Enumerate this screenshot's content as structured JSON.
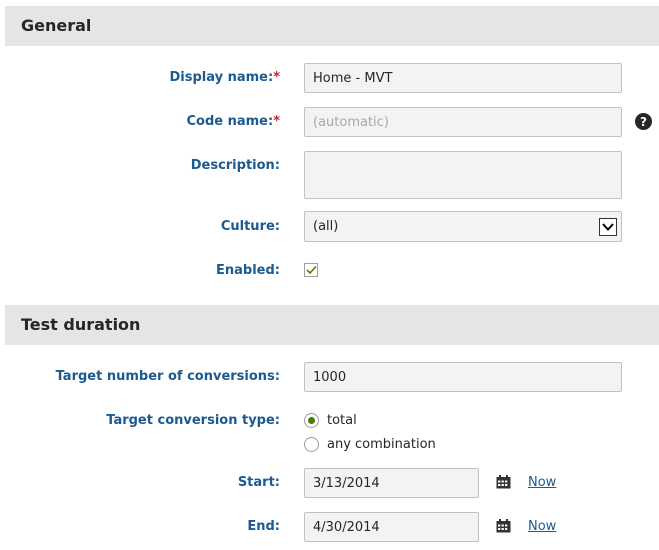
{
  "general": {
    "title": "General",
    "display_name": {
      "label": "Display name:",
      "required": "*",
      "value": "Home - MVT"
    },
    "code_name": {
      "label": "Code name:",
      "required": "*",
      "placeholder": "(automatic)",
      "help": "?"
    },
    "description": {
      "label": "Description:",
      "value": ""
    },
    "culture": {
      "label": "Culture:",
      "value": "(all)"
    },
    "enabled": {
      "label": "Enabled:",
      "checked": true
    }
  },
  "test_duration": {
    "title": "Test duration",
    "target_conversions": {
      "label": "Target number of conversions:",
      "value": "1000"
    },
    "conversion_type": {
      "label": "Target conversion type:",
      "options": [
        {
          "label": "total",
          "selected": true
        },
        {
          "label": "any combination",
          "selected": false
        }
      ]
    },
    "start": {
      "label": "Start:",
      "value": "3/13/2014",
      "now_label": "Now"
    },
    "end": {
      "label": "End:",
      "value": "4/30/2014",
      "now_label": "Now"
    }
  },
  "icons": {
    "calendar": "calendar-icon",
    "help": "help-icon",
    "checkmark": "checkmark-icon",
    "dropdown": "chevron-down-icon"
  },
  "colors": {
    "label": "#1c5a8f",
    "required": "#c2222e",
    "section_bg": "#e5e5e5",
    "radio_selected": "#497d04",
    "check": "#497d04"
  }
}
